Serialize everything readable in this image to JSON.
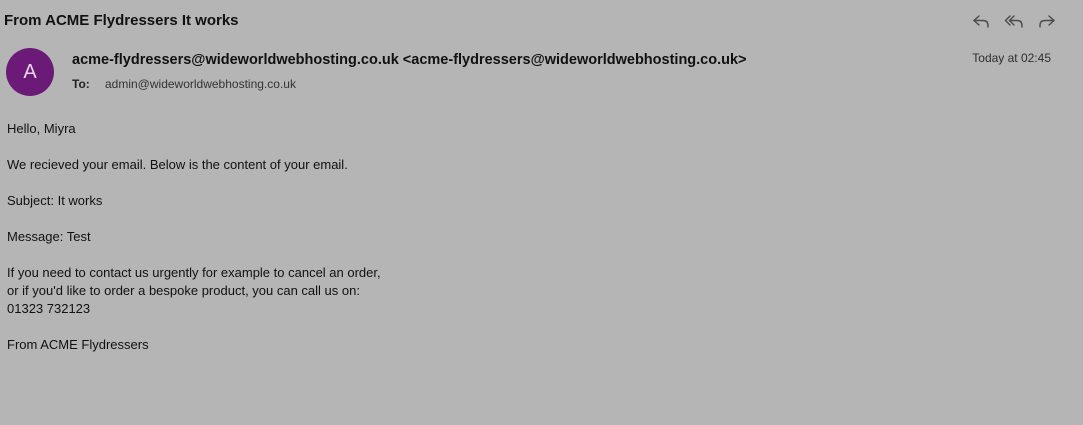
{
  "email": {
    "subject": "From ACME Flydressers It works",
    "avatar_letter": "A",
    "from": "acme-flydressers@wideworldwebhosting.co.uk <acme-flydressers@wideworldwebhosting.co.uk>",
    "to_label": "To:",
    "to_value": "admin@wideworldwebhosting.co.uk",
    "timestamp": "Today at 02:45"
  },
  "toolbar": {
    "icons": [
      "reply-icon",
      "reply-all-icon",
      "forward-icon"
    ]
  },
  "body": {
    "greeting": "Hello, Miyra",
    "intro": "We recieved your email. Below is the content of your email.",
    "subject_line": "Subject: It works",
    "message_line": "Message: Test",
    "contact_line1": "If you need to contact us urgently for example to cancel an order,",
    "contact_line2": "or if you'd like to order a bespoke product, you can call us on:",
    "phone": "01323 732123",
    "signoff": "From ACME Flydressers"
  },
  "colors": {
    "background": "#b5b5b5",
    "avatar": "#6c1a78"
  }
}
